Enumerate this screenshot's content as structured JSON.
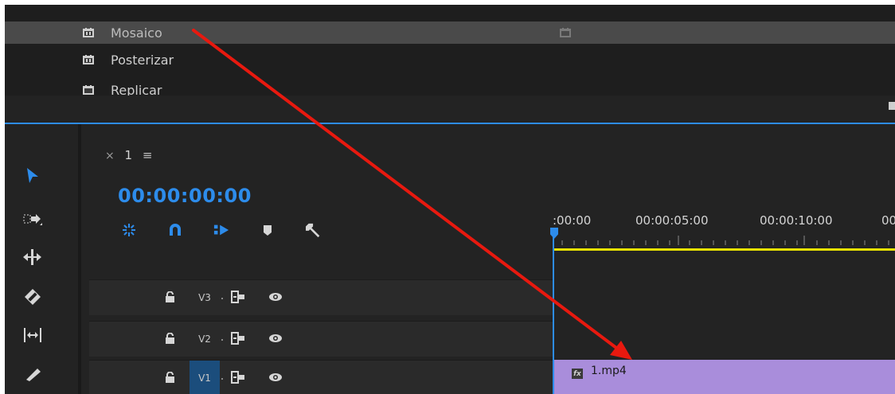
{
  "effects_list": {
    "items": [
      {
        "label": "Mosaico",
        "selected": true,
        "icon": "effect-preset-icon"
      },
      {
        "label": "Posterizar",
        "selected": false,
        "icon": "effect-preset-icon"
      },
      {
        "label": "Replicar",
        "selected": false,
        "icon": "effect-preset-icon"
      }
    ],
    "accelerated_icon": "gpu-accelerated-icon"
  },
  "tools": [
    "selection-tool-icon",
    "track-select-forward-icon",
    "ripple-edit-icon",
    "razor-tool-icon",
    "slip-tool-icon",
    "pen-tool-icon"
  ],
  "sequence": {
    "tab_close": "×",
    "tab_name": "1",
    "tab_menu": "≡",
    "timecode": "00:00:00:00",
    "toolbar_icons": [
      "nest-icon",
      "snap-magnet-icon",
      "linked-selection-icon",
      "add-marker-icon",
      "wrench-settings-icon"
    ]
  },
  "ruler": {
    "labels": [
      ":00:00",
      "00:00:05:00",
      "00:00:10:00",
      "00"
    ]
  },
  "tracks": [
    {
      "name": "V3",
      "active": false
    },
    {
      "name": "V2",
      "active": false
    },
    {
      "name": "V1",
      "active": true
    }
  ],
  "clip": {
    "name": "1.mp4",
    "fx_badge": "fx"
  },
  "colors": {
    "accent_blue": "#2d8ceb",
    "clip_purple": "#a98ddb",
    "work_area_yellow": "#e8e100",
    "annotation_arrow": "#e8190f"
  },
  "annotation": {
    "type": "arrow",
    "from": "Mosaico",
    "to": "1.mp4"
  }
}
